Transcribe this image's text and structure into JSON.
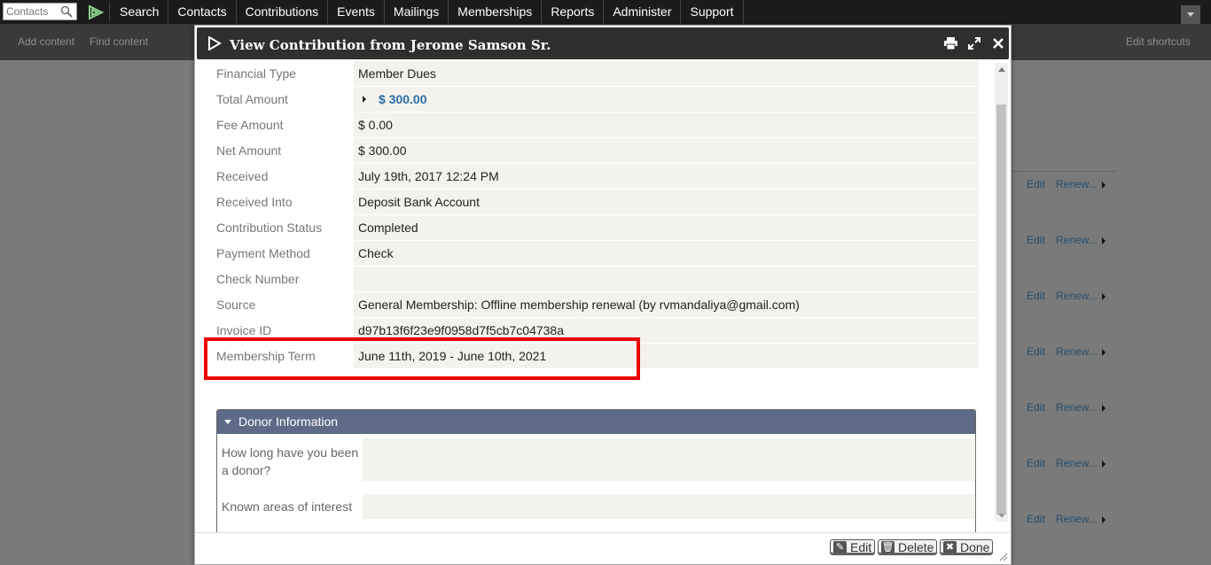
{
  "topbar": {
    "search_placeholder": "Contacts",
    "menu": [
      "Search",
      "Contacts",
      "Contributions",
      "Events",
      "Mailings",
      "Memberships",
      "Reports",
      "Administer",
      "Support"
    ]
  },
  "shortcuts": {
    "add_content": "Add content",
    "find_content": "Find content",
    "edit_shortcuts": "Edit shortcuts"
  },
  "background": {
    "row_actions": [
      {
        "edit": "Edit",
        "renew": "Renew..."
      },
      {
        "edit": "Edit",
        "renew": "Renew..."
      },
      {
        "edit": "Edit",
        "renew": "Renew..."
      },
      {
        "edit": "Edit",
        "renew": "Renew..."
      },
      {
        "edit": "Edit",
        "renew": "Renew..."
      },
      {
        "edit": "Edit",
        "renew": "Renew..."
      },
      {
        "edit": "Edit",
        "renew": "Renew..."
      }
    ]
  },
  "dialog": {
    "title": "View Contribution from Jerome Samson Sr.",
    "details": [
      {
        "label": "Financial Type",
        "value": "Member Dues"
      },
      {
        "label": "Total Amount",
        "value": "$ 300.00"
      },
      {
        "label": "Fee Amount",
        "value": "$ 0.00"
      },
      {
        "label": "Net Amount",
        "value": "$ 300.00"
      },
      {
        "label": "Received",
        "value": "July 19th, 2017 12:24 PM"
      },
      {
        "label": "Received Into",
        "value": "Deposit Bank Account"
      },
      {
        "label": "Contribution Status",
        "value": "Completed"
      },
      {
        "label": "Payment Method",
        "value": "Check"
      },
      {
        "label": "Check Number",
        "value": ""
      },
      {
        "label": "Source",
        "value": "General Membership: Offline membership renewal (by rvmandaliya@gmail.com)"
      },
      {
        "label": "Invoice ID",
        "value": "d97b13f6f23e9f0958d7f5cb7c04738a"
      },
      {
        "label": "Membership Term",
        "value": "June 11th, 2019 - June 10th, 2021"
      }
    ],
    "donor": {
      "heading": "Donor Information",
      "fields": [
        {
          "label": "How long have you been a donor?",
          "value": ""
        },
        {
          "label": "Known areas of interest",
          "value": ""
        }
      ]
    },
    "buttons": {
      "edit": "Edit",
      "delete": "Delete",
      "done": "Done"
    }
  },
  "colors": {
    "nav_bg": "#1b1b1b",
    "title_bg": "#2f2f2e",
    "donor_header": "#5d6b86",
    "highlight": "#e00000",
    "link": "#2b6da8"
  }
}
